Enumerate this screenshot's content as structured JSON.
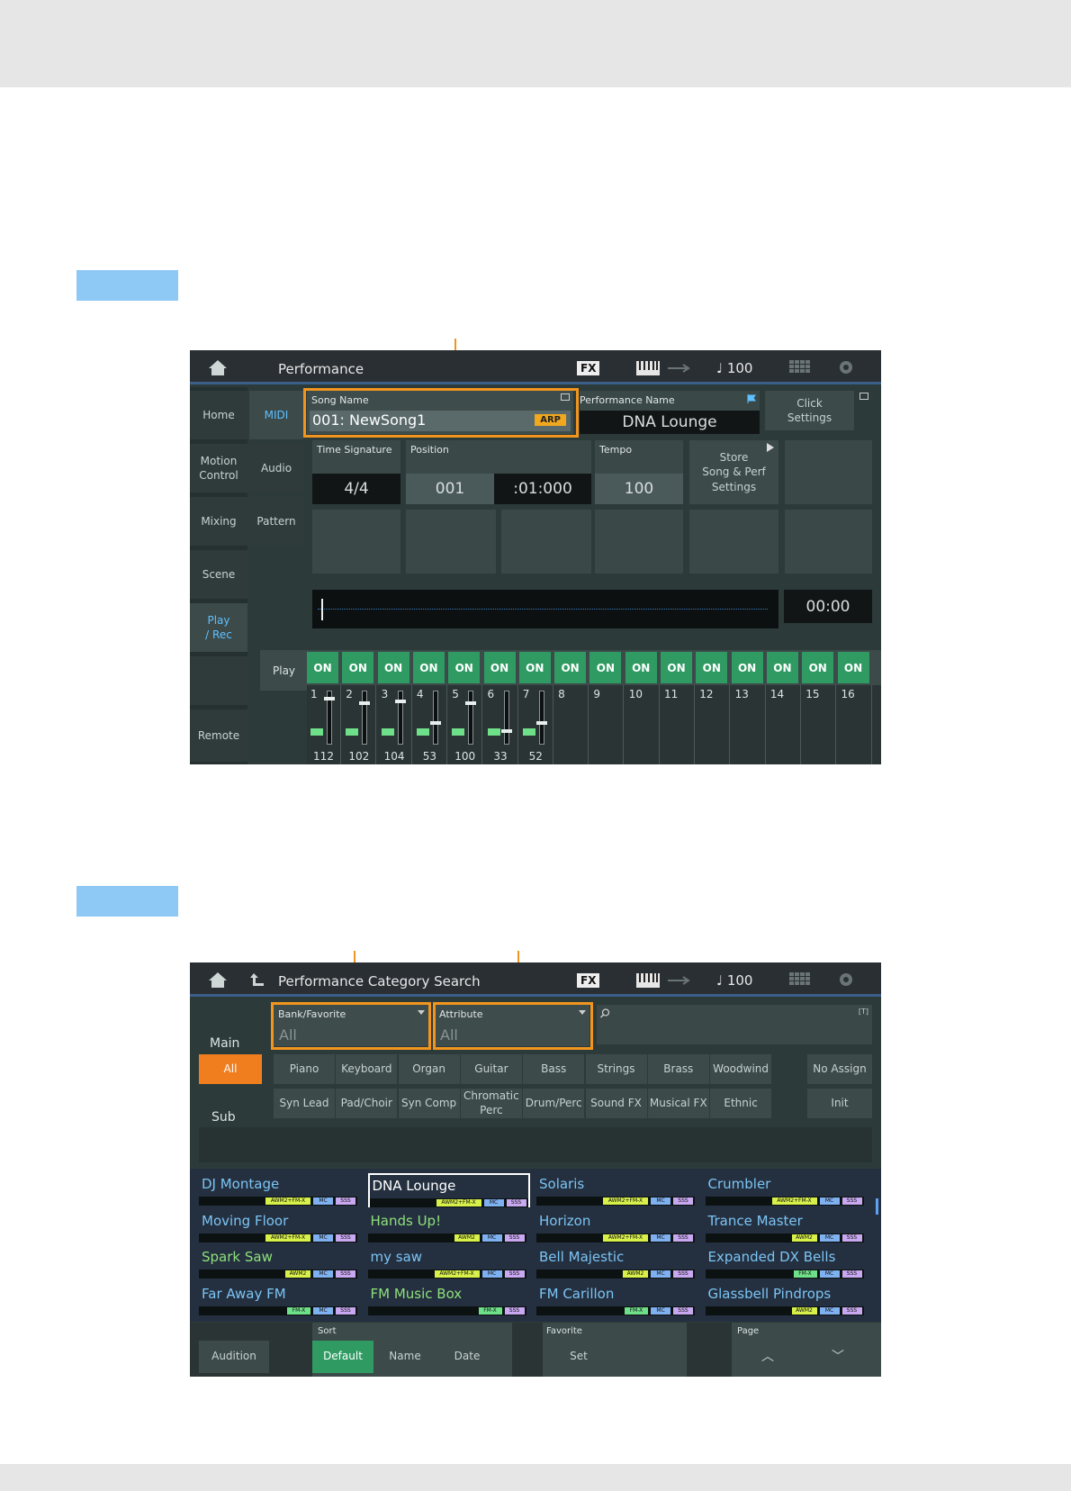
{
  "screen1": {
    "title": "Performance",
    "fx": "FX",
    "tempo_display": "♩ 100",
    "tabs_left": [
      "Home",
      "Motion\nControl",
      "Mixing",
      "Scene",
      "Play\n/ Rec",
      "Remote"
    ],
    "tabs_mid": [
      "MIDI",
      "Audio",
      "Pattern"
    ],
    "song_name_label": "Song Name",
    "song_name": "001: NewSong1",
    "arp_badge": "ARP",
    "performance_name_label": "Performance Name",
    "performance_name": "DNA Lounge",
    "click_settings": "Click\nSettings",
    "time_signature_label": "Time Signature",
    "time_signature": "4/4",
    "position_label": "Position",
    "position_measure": "001",
    "position_beat": ":01:000",
    "tempo_label": "Tempo",
    "tempo": "100",
    "store_button": "Store\nSong & Perf\nSettings",
    "time_display": "00:00",
    "play_label": "Play",
    "on_label": "ON",
    "channels": [
      {
        "num": "1",
        "val": "112",
        "level": 0.88
      },
      {
        "num": "2",
        "val": "102",
        "level": 0.8
      },
      {
        "num": "3",
        "val": "104",
        "level": 0.82
      },
      {
        "num": "4",
        "val": "53",
        "level": 0.42
      },
      {
        "num": "5",
        "val": "100",
        "level": 0.79
      },
      {
        "num": "6",
        "val": "33",
        "level": 0.26
      },
      {
        "num": "7",
        "val": "52",
        "level": 0.41
      },
      {
        "num": "8",
        "val": ""
      },
      {
        "num": "9",
        "val": ""
      },
      {
        "num": "10",
        "val": ""
      },
      {
        "num": "11",
        "val": ""
      },
      {
        "num": "12",
        "val": ""
      },
      {
        "num": "13",
        "val": ""
      },
      {
        "num": "14",
        "val": ""
      },
      {
        "num": "15",
        "val": ""
      },
      {
        "num": "16",
        "val": ""
      }
    ]
  },
  "screen2": {
    "title": "Performance Category Search",
    "fx": "FX",
    "tempo_display": "♩ 100",
    "bank_label": "Bank/Favorite",
    "bank_value": "All",
    "attribute_label": "Attribute",
    "attribute_value": "All",
    "text_icon": "[T]",
    "main_label": "Main",
    "sub_label": "Sub",
    "all_button": "All",
    "main_categories": [
      "Piano",
      "Keyboard",
      "Organ",
      "Guitar",
      "Bass",
      "Strings",
      "Brass",
      "Woodwind"
    ],
    "no_assign": "No Assign",
    "sub_categories": [
      "Syn Lead",
      "Pad/Choir",
      "Syn Comp",
      "Chromatic\nPerc",
      "Drum/Perc",
      "Sound FX",
      "Musical FX",
      "Ethnic"
    ],
    "init": "Init",
    "results": [
      {
        "name": "DJ Montage",
        "color": "blue",
        "tags": [
          "AWM2+FM-X",
          "MC",
          "SSS"
        ]
      },
      {
        "name": "DNA Lounge",
        "color": "white",
        "tags": [
          "AWM2+FM-X",
          "MC",
          "SSS"
        ],
        "selected": true
      },
      {
        "name": "Solaris",
        "color": "blue",
        "tags": [
          "AWM2+FM-X",
          "MC",
          "SSS"
        ]
      },
      {
        "name": "Crumbler",
        "color": "blue",
        "tags": [
          "AWM2+FM-X",
          "MC",
          "SSS"
        ]
      },
      {
        "name": "Moving Floor",
        "color": "blue",
        "tags": [
          "AWM2+FM-X",
          "MC",
          "SSS"
        ]
      },
      {
        "name": "Hands Up!",
        "color": "green",
        "tags": [
          "AWM2",
          "MC",
          "SSS"
        ]
      },
      {
        "name": "Horizon",
        "color": "blue",
        "tags": [
          "AWM2+FM-X",
          "MC",
          "SSS"
        ]
      },
      {
        "name": "Trance Master",
        "color": "blue",
        "tags": [
          "AWM2",
          "MC",
          "SSS"
        ]
      },
      {
        "name": "Spark Saw",
        "color": "green",
        "tags": [
          "AWM2",
          "MC",
          "SSS"
        ]
      },
      {
        "name": "my saw",
        "color": "blue",
        "tags": [
          "AWM2+FM-X",
          "MC",
          "SSS"
        ]
      },
      {
        "name": "Bell Majestic",
        "color": "blue",
        "tags": [
          "AWM2",
          "MC",
          "SSS"
        ]
      },
      {
        "name": "Expanded DX Bells",
        "color": "blue",
        "tags": [
          "FM-X",
          "MC",
          "SSS"
        ]
      },
      {
        "name": "Far Away FM",
        "color": "blue",
        "tags": [
          "FM-X",
          "MC",
          "SSS"
        ]
      },
      {
        "name": "FM Music Box",
        "color": "green",
        "tags": [
          "FM-X",
          "SSS"
        ]
      },
      {
        "name": "FM Carillon",
        "color": "blue",
        "tags": [
          "FM-X",
          "MC",
          "SSS"
        ]
      },
      {
        "name": "Glassbell Pindrops",
        "color": "blue",
        "tags": [
          "AWM2",
          "MC",
          "SSS"
        ]
      }
    ],
    "audition": "Audition",
    "sort_label": "Sort",
    "sort_default": "Default",
    "sort_name": "Name",
    "sort_date": "Date",
    "favorite_label": "Favorite",
    "favorite_set": "Set",
    "page_label": "Page",
    "page_up": "︿",
    "page_down": "﹀"
  }
}
